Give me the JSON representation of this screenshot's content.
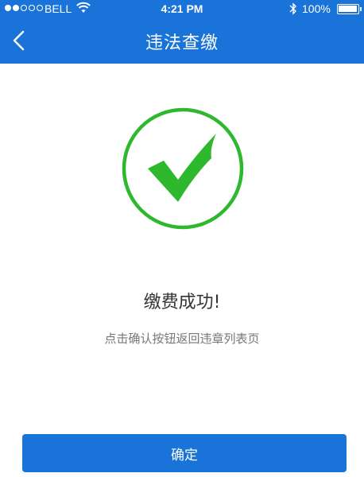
{
  "status_bar": {
    "carrier": "BELL",
    "time": "4:21 PM",
    "battery": "100%",
    "signal_bars_filled": 2,
    "signal_bars_total": 5
  },
  "nav": {
    "title": "违法查缴",
    "back_icon": "chevron-left-icon"
  },
  "result": {
    "icon": "checkmark-circle-icon",
    "message": "缴费成功!",
    "hint": "点击确认按钮返回违章列表页"
  },
  "footer": {
    "confirm_label": "确定"
  },
  "colors": {
    "primary": "#1a73d9",
    "success": "#2db82d"
  }
}
